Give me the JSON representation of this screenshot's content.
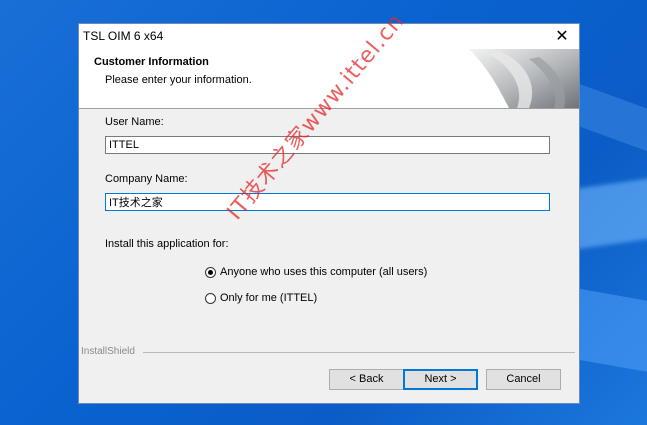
{
  "window": {
    "title": "TSL OIM 6 x64"
  },
  "header": {
    "title": "Customer Information",
    "subtitle": "Please enter your information."
  },
  "form": {
    "user_name_label": "User Name:",
    "user_name_value": "ITTEL",
    "company_name_label": "Company Name:",
    "company_name_value": "IT技术之家",
    "install_for_label": "Install this application for:",
    "options": [
      {
        "label": "Anyone who uses this computer (all users)",
        "selected": true
      },
      {
        "label": "Only for me (ITTEL)",
        "selected": false
      }
    ]
  },
  "footer": {
    "brand": "InstallShield",
    "back_label": "< Back",
    "next_label": "Next >",
    "cancel_label": "Cancel"
  },
  "watermark": "IT技术之家www.ittel.cn",
  "icons": {
    "close": "close-icon",
    "radio_on": "radio-checked-icon",
    "radio_off": "radio-unchecked-icon"
  },
  "colors": {
    "accent": "#0078d7",
    "desktop": "#0a63d0"
  }
}
